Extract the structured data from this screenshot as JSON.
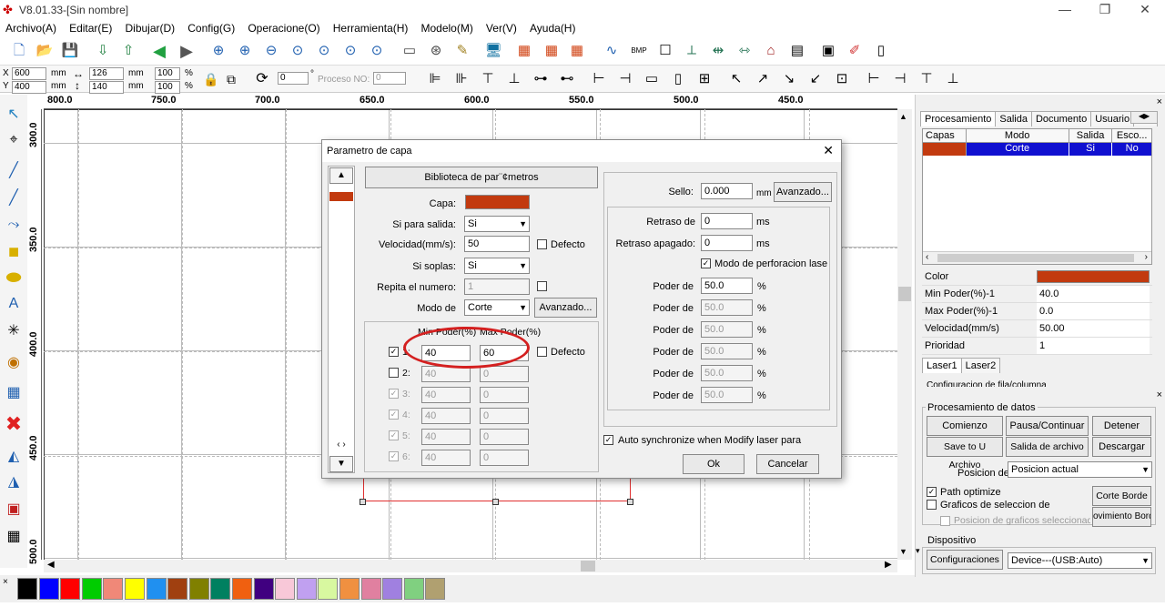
{
  "window": {
    "title": "V8.01.33-[Sin nombre]",
    "min": "—",
    "max": "❐",
    "close": "✕"
  },
  "menu": [
    "Archivo(A)",
    "Editar(E)",
    "Dibujar(D)",
    "Config(G)",
    "Operacione(O)",
    "Herramienta(H)",
    "Modelo(M)",
    "Ver(V)",
    "Ayuda(H)"
  ],
  "coords": {
    "x_label": "X",
    "y_label": "Y",
    "x": "600",
    "y": "400",
    "unit": "mm",
    "w": "126",
    "h": "140",
    "w_unit": "mm",
    "h_unit": "mm",
    "pct_w": "100",
    "pct_h": "100",
    "pct": "%",
    "angle": "0",
    "deg": "°",
    "proceso_label": "Proceso NO:",
    "proceso": "0"
  },
  "ruler_top": [
    "800.0",
    "750.0",
    "700.0",
    "650.0",
    "600.0",
    "550.0",
    "500.0",
    "450.0"
  ],
  "ruler_left": [
    "300.0",
    "350.0",
    "400.0",
    "450.0",
    "500.0"
  ],
  "dialog": {
    "title": "Parametro de capa",
    "close": "✕",
    "biblioteca": "Biblioteca de par¨¢metros",
    "capa_label": "Capa:",
    "capa_color": "#c23a0f",
    "salida_label": "Si para salida:",
    "salida": "Si",
    "velocidad_label": "Velocidad(mm/s):",
    "velocidad": "50",
    "defecto": "Defecto",
    "soplas_label": "Si soplas:",
    "soplas": "Si",
    "repita_label": "Repita el numero:",
    "repita": "1",
    "modo_label": "Modo de",
    "modo": "Corte",
    "avanzado": "Avanzado...",
    "min_header": "Min Poder(%)",
    "max_header": "Max Poder(%)",
    "rows": [
      {
        "num": "1:",
        "min": "40",
        "max": "60",
        "checked": true,
        "enabled": true
      },
      {
        "num": "2:",
        "min": "40",
        "max": "0",
        "checked": false,
        "enabled": true
      },
      {
        "num": "3:",
        "min": "40",
        "max": "0",
        "checked": true,
        "enabled": false
      },
      {
        "num": "4:",
        "min": "40",
        "max": "0",
        "checked": true,
        "enabled": false
      },
      {
        "num": "5:",
        "min": "40",
        "max": "0",
        "checked": true,
        "enabled": false
      },
      {
        "num": "6:",
        "min": "40",
        "max": "0",
        "checked": true,
        "enabled": false
      }
    ],
    "row_defecto": "Defecto",
    "sello_label": "Sello:",
    "sello": "0.000",
    "sello_unit": "mm",
    "sello_avanzado": "Avanzado...",
    "retraso_label": "Retraso de",
    "retraso": "0",
    "ms": "ms",
    "retraso_apagado_label": "Retraso apagado:",
    "retraso_apagado": "0",
    "perforacion": "Modo de perforacion lase",
    "poder_label": "Poder de",
    "poder": [
      "50.0",
      "50.0",
      "50.0",
      "50.0",
      "50.0",
      "50.0"
    ],
    "pct": "%",
    "autosync": "Auto synchronize when Modify laser para",
    "ok": "Ok",
    "cancel": "Cancelar"
  },
  "right": {
    "tabs": [
      "Procesamiento",
      "Salida",
      "Documento",
      "Usuario",
      "Pru"
    ],
    "table_headers": [
      "Capas",
      "Modo",
      "Salida",
      "Esco..."
    ],
    "table_row": {
      "color": "#c23a0f",
      "modo": "Corte",
      "salida": "Si",
      "esco": "No"
    },
    "props": [
      [
        "Color",
        ""
      ],
      [
        "Min Poder(%)-1",
        "40.0"
      ],
      [
        "Max Poder(%)-1",
        "0.0"
      ],
      [
        "Velocidad(mm/s)",
        "50.00"
      ],
      [
        "Prioridad",
        "1"
      ]
    ],
    "laser_tabs": [
      "Laser1",
      "Laser2"
    ],
    "config_cut": "Configuracion de fila/columna",
    "proc_title": "Procesamiento de datos",
    "buttons": [
      "Comienzo",
      "Pausa/Continuar",
      "Detener",
      "Save to U Archivo",
      "Salida de archivo U",
      "Descargar"
    ],
    "posicion_label": "Posicion de",
    "posicion": "Posicion actual",
    "path_opt": "Path optimize",
    "graficos": "Graficos de seleccion de",
    "pos_graficos": "Posicion de graficos seleccionado",
    "corte_borde": "Corte Borde",
    "movimiento": "ovimiento Borde",
    "dispositivo": "Dispositivo",
    "config_btn": "Configuraciones",
    "device": "Device---(USB:Auto)"
  },
  "palette": [
    "#000000",
    "#0000ff",
    "#ff0000",
    "#00cc00",
    "#f08878",
    "#ffff00",
    "#2090f0",
    "#a04010",
    "#808000",
    "#008060",
    "#f06010",
    "#400080",
    "#f8c8d8",
    "#c0a0f0",
    "#d8f8a0",
    "#f09040",
    "#e080a0",
    "#a080e0",
    "#80d080",
    "#b0a070"
  ]
}
